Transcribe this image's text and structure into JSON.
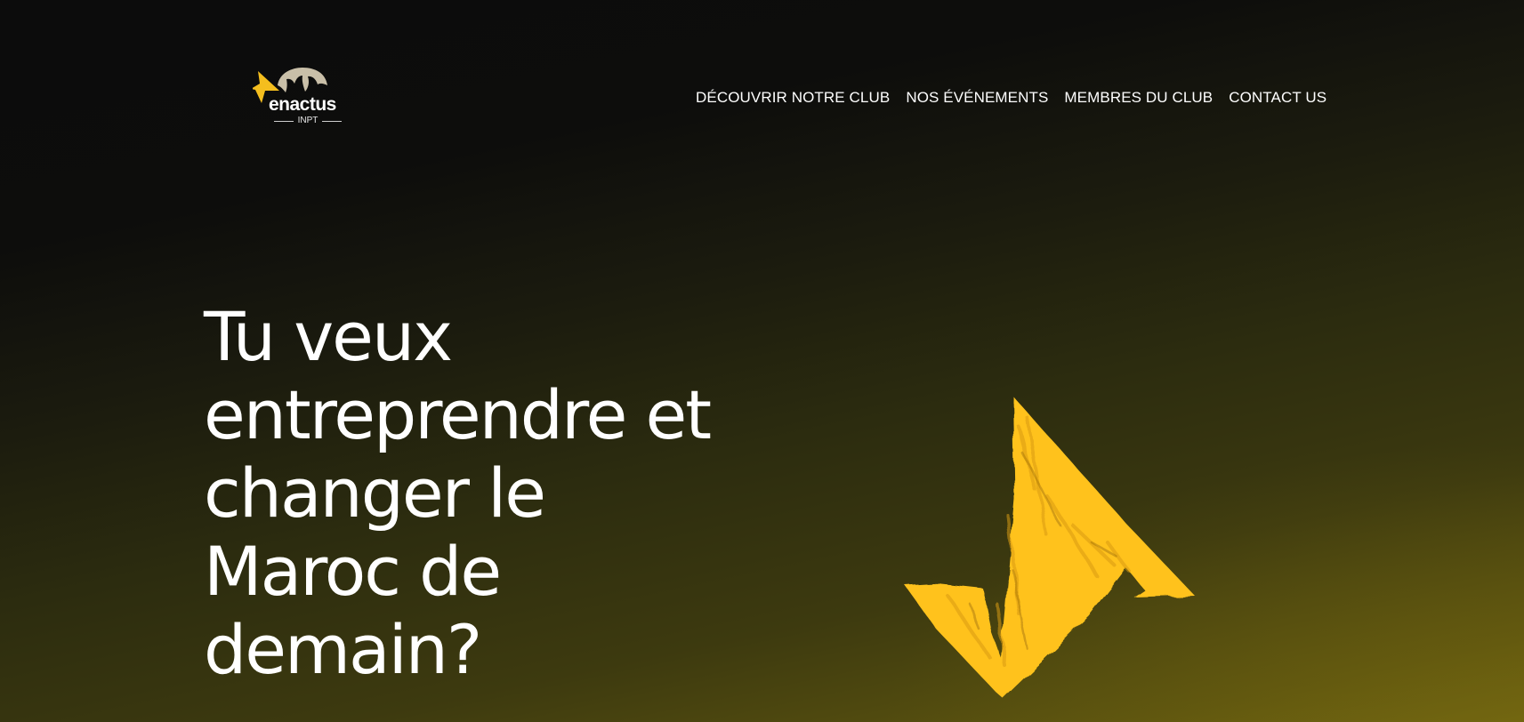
{
  "logo": {
    "brand": "enactus",
    "sub": "INPT",
    "icon": "enactus-logo-icon",
    "colors": {
      "arrow": "#F4BE1E",
      "crest": "#C9BFA8"
    }
  },
  "nav": {
    "items": [
      {
        "label": "DÉCOUVRIR NOTRE CLUB"
      },
      {
        "label": "NOS ÉVÉNEMENTS"
      },
      {
        "label": "MEMBRES DU CLUB"
      },
      {
        "label": "CONTACT US"
      }
    ]
  },
  "hero": {
    "headline": "Tu veux entreprendre et changer le Maroc de demain?",
    "illustration": "yellow-arrow-mark-icon",
    "accent_color": "#FFC21F"
  },
  "colors": {
    "background_top": "#0C0C0C",
    "background_bottom": "#6E6410",
    "text": "#FFFFFF"
  }
}
